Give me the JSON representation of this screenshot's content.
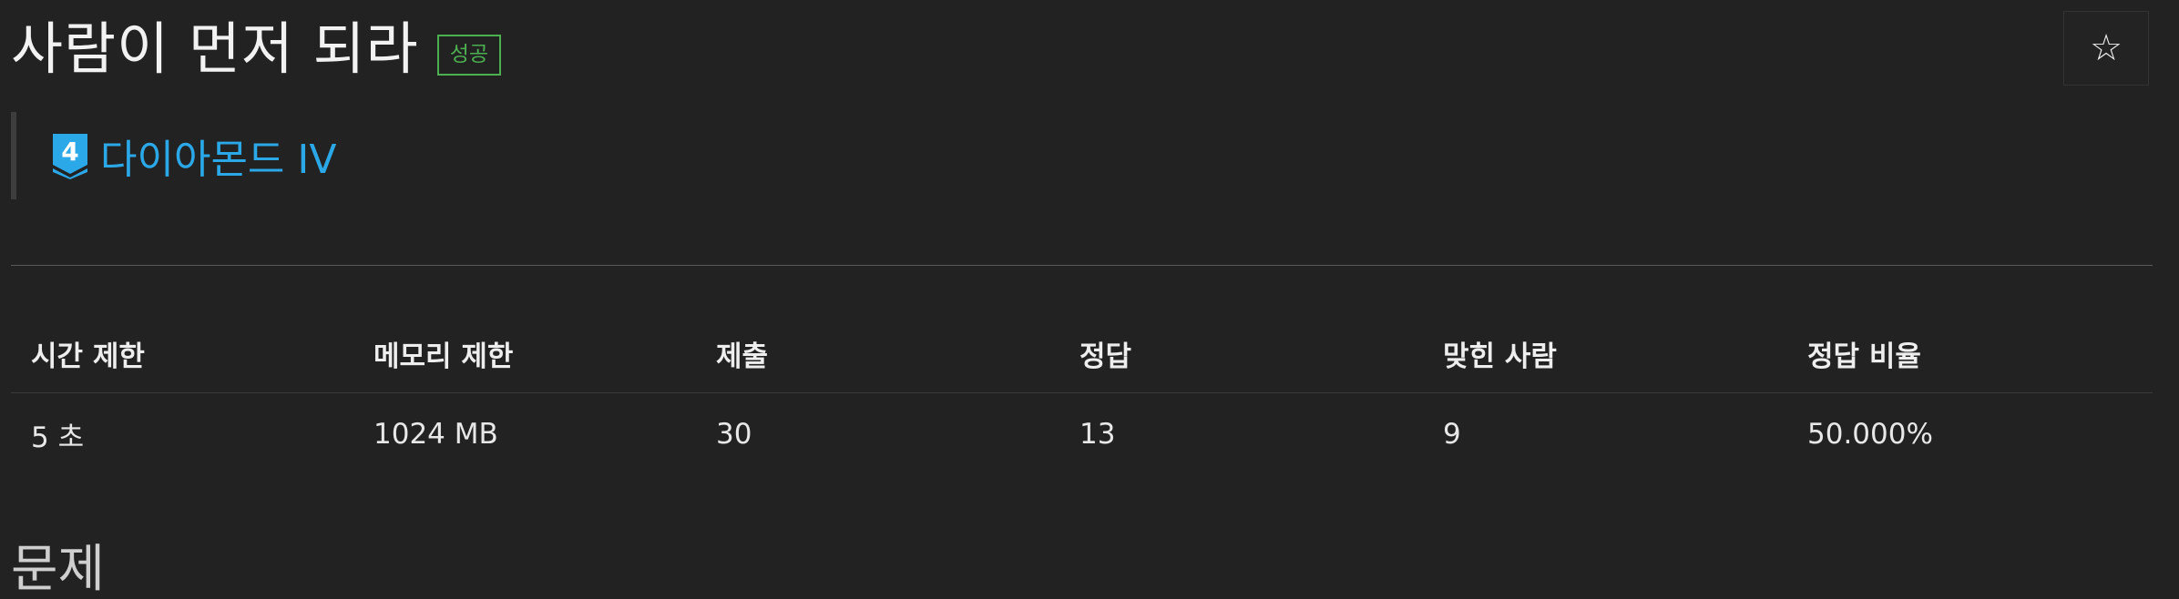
{
  "problem": {
    "title": "사람이 먼저 되라",
    "status_badge": "성공",
    "star_icon": "☆"
  },
  "tier": {
    "number": "4",
    "label": "다이아몬드 IV",
    "color": "#2ba8e8"
  },
  "stats": {
    "headers": [
      "시간 제한",
      "메모리 제한",
      "제출",
      "정답",
      "맞힌 사람",
      "정답 비율"
    ],
    "values": [
      "5 초",
      "1024 MB",
      "30",
      "13",
      "9",
      "50.000%"
    ]
  },
  "section": {
    "title": "문제"
  }
}
